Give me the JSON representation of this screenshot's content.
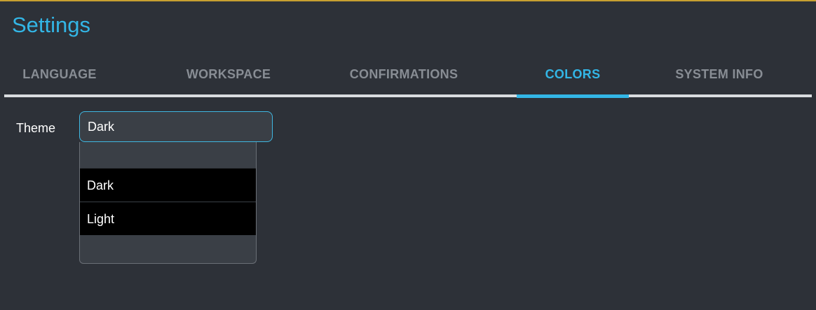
{
  "header": {
    "title": "Settings"
  },
  "tabs": [
    {
      "label": "LANGUAGE",
      "active": false
    },
    {
      "label": "WORKSPACE",
      "active": false
    },
    {
      "label": "CONFIRMATIONS",
      "active": false
    },
    {
      "label": "COLORS",
      "active": true
    },
    {
      "label": "SYSTEM INFO",
      "active": false
    }
  ],
  "colors_panel": {
    "theme_label": "Theme",
    "theme_value": "Dark",
    "theme_options": [
      "Dark",
      "Light"
    ]
  },
  "palette": {
    "accent": "#33b6e6",
    "background": "#2d3138",
    "inactive_tab": "#888d94"
  }
}
